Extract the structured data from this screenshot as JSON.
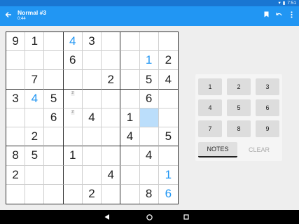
{
  "status": {
    "time": "7:51"
  },
  "appbar": {
    "title": "Normal #3",
    "timer": "0:44"
  },
  "colors": {
    "status_bar": "#1976d2",
    "app_bar": "#2196f3",
    "user_digit": "#2196f3",
    "selected_cell": "#bbdefb"
  },
  "board": {
    "rows": [
      [
        "9",
        "1",
        "",
        "4",
        "3",
        "",
        "",
        "",
        ""
      ],
      [
        "",
        "",
        "",
        "6",
        "",
        "",
        "",
        "1",
        "2"
      ],
      [
        "",
        "7",
        "",
        "",
        "",
        "2",
        "",
        "5",
        "4"
      ],
      [
        "3",
        "4",
        "5",
        "",
        "",
        "",
        "",
        "6",
        ""
      ],
      [
        "",
        "",
        "6",
        "",
        "4",
        "",
        "1",
        "",
        ""
      ],
      [
        "",
        "2",
        "",
        "",
        "",
        "",
        "4",
        "",
        "5"
      ],
      [
        "8",
        "5",
        "",
        "1",
        "",
        "",
        "",
        "4",
        ""
      ],
      [
        "2",
        "",
        "",
        "",
        "",
        "4",
        "",
        "",
        "1"
      ],
      [
        "",
        "",
        "",
        "",
        "2",
        "",
        "",
        "8",
        "6"
      ]
    ],
    "user_cells": [
      [
        0,
        3
      ],
      [
        1,
        7
      ],
      [
        3,
        1
      ],
      [
        7,
        8
      ],
      [
        8,
        8
      ]
    ],
    "notes": [
      {
        "row": 3,
        "col": 3,
        "value": "2"
      },
      {
        "row": 4,
        "col": 3,
        "value": "2"
      }
    ],
    "selected": [
      4,
      7
    ]
  },
  "keypad": {
    "digits": [
      "1",
      "2",
      "3",
      "4",
      "5",
      "6",
      "7",
      "8",
      "9"
    ],
    "notes_label": "NOTES",
    "clear_label": "CLEAR"
  },
  "icons": {
    "back": "arrow-back-icon",
    "bookmark": "bookmark-icon",
    "undo": "undo-icon",
    "menu": "more-vert-icon",
    "nav_back": "nav-back-icon",
    "nav_home": "nav-home-icon",
    "nav_recents": "nav-recents-icon"
  }
}
